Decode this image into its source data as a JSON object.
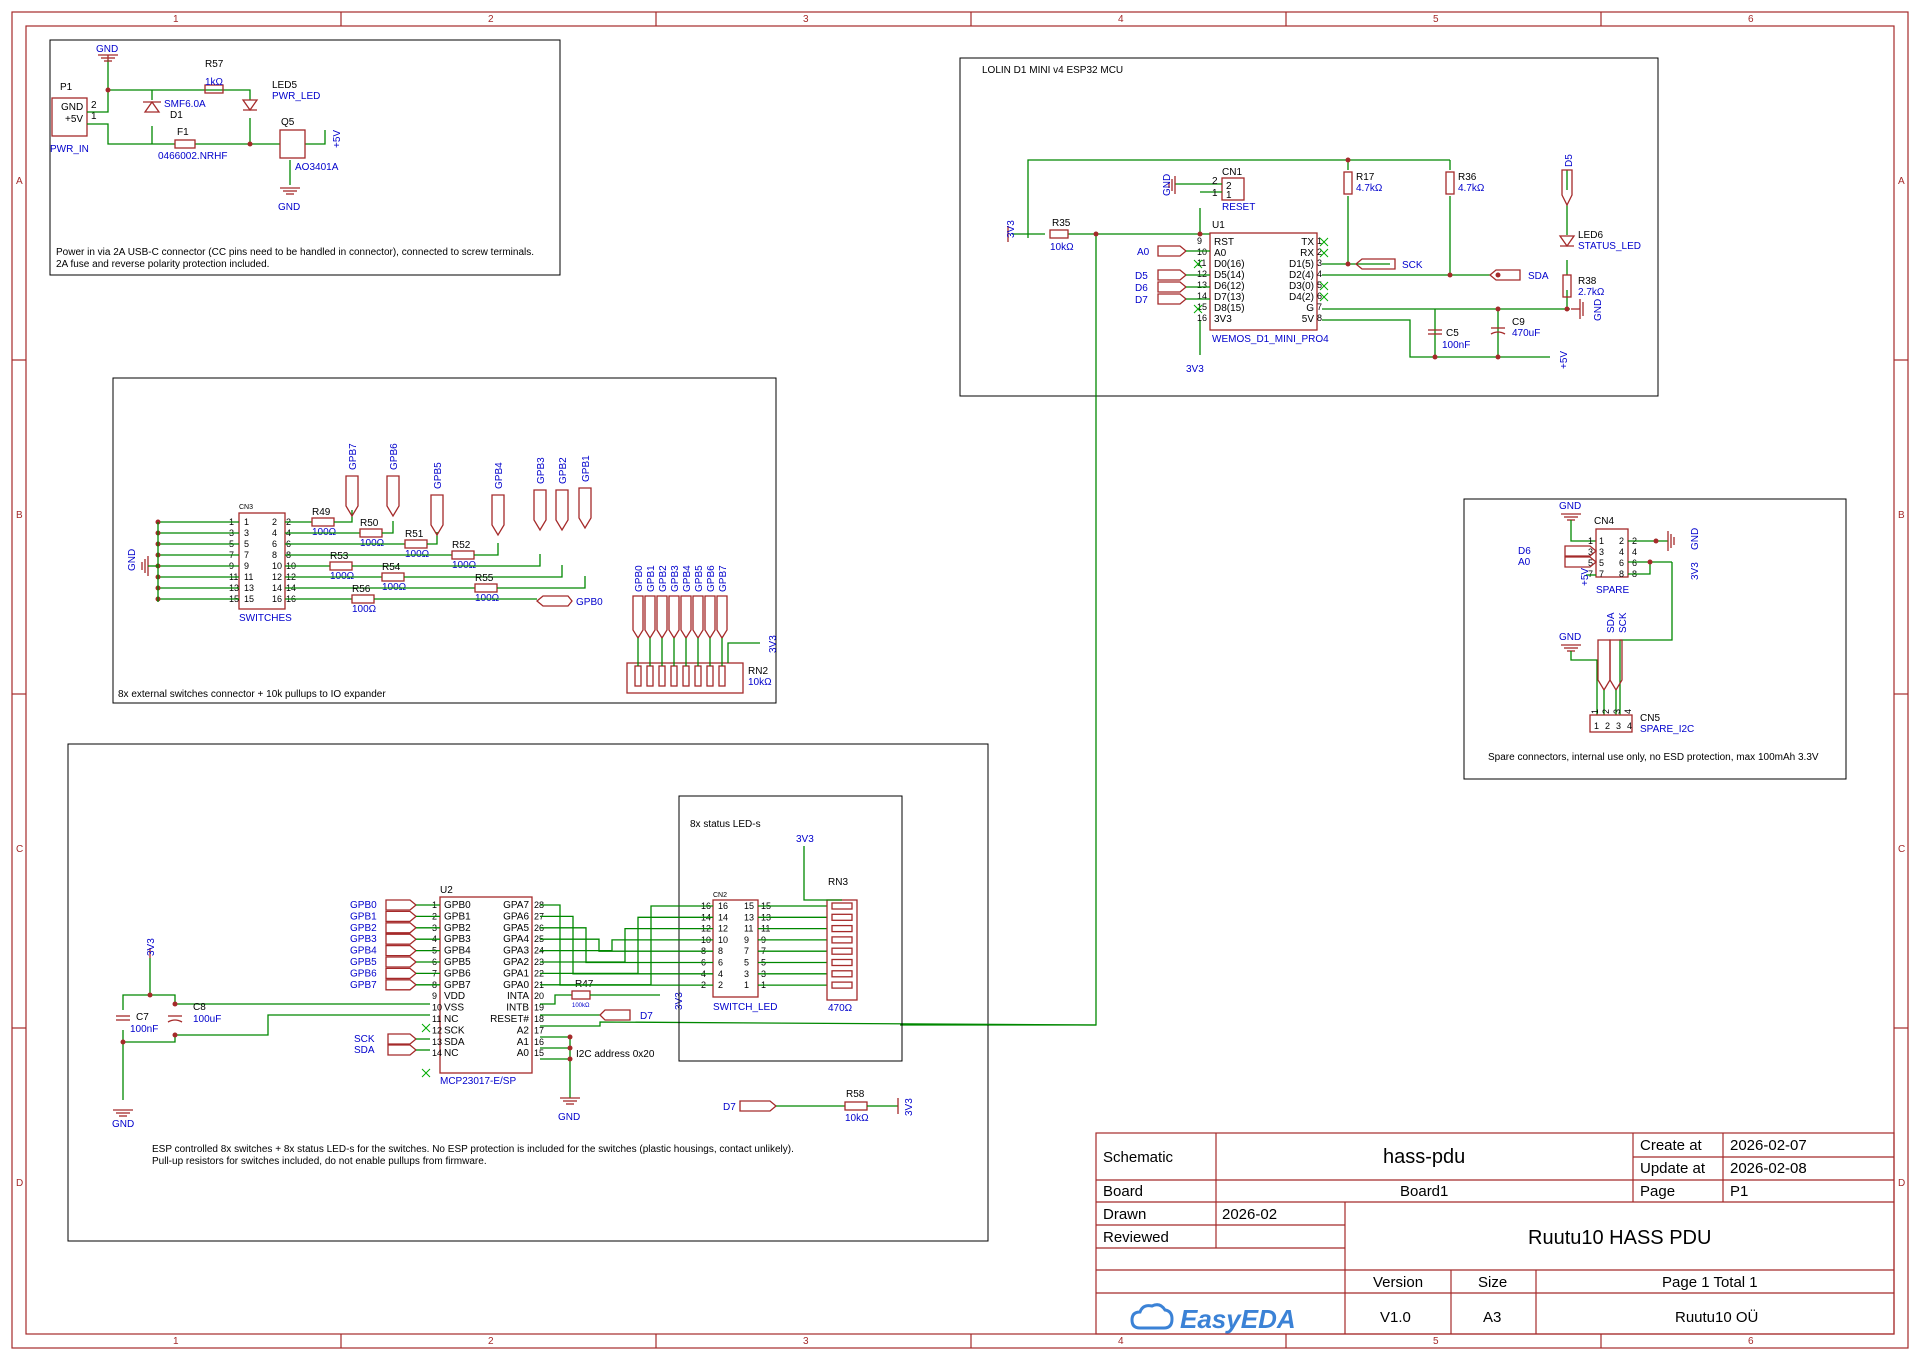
{
  "sheet": {
    "col_labels": [
      "1",
      "2",
      "3",
      "4",
      "5",
      "6"
    ],
    "row_labels": [
      "A",
      "B",
      "C",
      "D"
    ]
  },
  "power": {
    "note_line1": "Power in via 2A USB-C connector (CC pins need to be handled in connector), connected to screw terminals.",
    "note_line2": "2A fuse and reverse polarity protection included.",
    "p1_ref": "P1",
    "p1_name": "PWR_IN",
    "p1_pin_gnd": "GND",
    "p1_pin_5v": "+5V",
    "p1_num2": "2",
    "p1_num1": "1",
    "gnd_top": "GND",
    "gnd_bottom": "GND",
    "r57_ref": "R57",
    "r57_val": "1kΩ",
    "led5_ref": "LED5",
    "led5_name": "PWR_LED",
    "d1_part": "SMF6.0A",
    "d1_ref": "D1",
    "f1_ref": "F1",
    "f1_part": "0466002.NRHF",
    "q5_ref": "Q5",
    "q5_part": "AO3401A",
    "p5v": "+5V"
  },
  "mcu": {
    "title": "LOLIN D1 MINI v4 ESP32 MCU",
    "cn1_ref": "CN1",
    "cn1_name": "RESET",
    "cn1_p2": "2",
    "cn1_p1": "1",
    "gnd": "GND",
    "v33_left": "3V3",
    "r35_ref": "R35",
    "r35_val": "10kΩ",
    "r17_ref": "R17",
    "r17_val": "4.7kΩ",
    "r36_ref": "R36",
    "r36_val": "4.7kΩ",
    "u1_ref": "U1",
    "u1_name": "WEMOS_D1_MINI_PRO4",
    "left_pins": [
      {
        "num": "9",
        "name": "RST"
      },
      {
        "num": "10",
        "name": "A0"
      },
      {
        "num": "11",
        "name": "D0(16)"
      },
      {
        "num": "12",
        "name": "D5(14)"
      },
      {
        "num": "13",
        "name": "D6(12)"
      },
      {
        "num": "14",
        "name": "D7(13)"
      },
      {
        "num": "15",
        "name": "D8(15)"
      },
      {
        "num": "16",
        "name": "3V3"
      }
    ],
    "right_pins": [
      {
        "num": "1",
        "name": "TX"
      },
      {
        "num": "2",
        "name": "RX"
      },
      {
        "num": "3",
        "name": "D1(5)"
      },
      {
        "num": "4",
        "name": "D2(4)"
      },
      {
        "num": "5",
        "name": "D3(0)"
      },
      {
        "num": "6",
        "name": "D4(2)"
      },
      {
        "num": "7",
        "name": "G"
      },
      {
        "num": "8",
        "name": "5V"
      }
    ],
    "net_a0": "A0",
    "net_d5": "D5",
    "net_d6": "D6",
    "net_d7": "D7",
    "net_sck": "SCK",
    "net_sda": "SDA",
    "v33_bottom": "3V3",
    "c5_ref": "C5",
    "c5_val": "100nF",
    "c9_ref": "C9",
    "c9_val": "470uF",
    "p5v": "+5V",
    "d5_net": "D5",
    "led6_ref": "LED6",
    "led6_name": "STATUS_LED",
    "r38_ref": "R38",
    "r38_val": "2.7kΩ",
    "gnd_r": "GND"
  },
  "switches": {
    "note": "8x external switches connector + 10k pullups to IO expander",
    "cn3_ref": "CN3",
    "cn3_name": "SWITCHES",
    "gnd": "GND",
    "left_nums": [
      "1",
      "3",
      "5",
      "7",
      "9",
      "11",
      "13",
      "15"
    ],
    "right_nums": [
      "2",
      "4",
      "6",
      "8",
      "10",
      "12",
      "14",
      "16"
    ],
    "ref_nets": [
      "GPB7",
      "GPB6",
      "GPB5",
      "GPB4",
      "GPB3",
      "GPB2",
      "GPB1"
    ],
    "gpb0": "GPB0",
    "resistors": [
      {
        "ref": "R49",
        "val": "100Ω"
      },
      {
        "ref": "R50",
        "val": "100Ω"
      },
      {
        "ref": "R51",
        "val": "100Ω"
      },
      {
        "ref": "R52",
        "val": "100Ω"
      },
      {
        "ref": "R53",
        "val": "100Ω"
      },
      {
        "ref": "R54",
        "val": "100Ω"
      },
      {
        "ref": "R55",
        "val": "100Ω"
      },
      {
        "ref": "R56",
        "val": "100Ω"
      }
    ],
    "rn2_nets": [
      "GPB0",
      "GPB1",
      "GPB2",
      "GPB3",
      "GPB4",
      "GPB5",
      "GPB6",
      "GPB7"
    ],
    "rn2_ref": "RN2",
    "rn2_val": "10kΩ",
    "v33": "3V3"
  },
  "spare": {
    "note": "Spare connectors, internal use only, no ESD protection, max 100mAh 3.3V",
    "gnd_top": "GND",
    "cn4_ref": "CN4",
    "cn4_name": "SPARE",
    "cn4_left": [
      "1",
      "3",
      "5",
      "7"
    ],
    "cn4_right": [
      "2",
      "4",
      "6",
      "8"
    ],
    "net_d6": "D6",
    "net_a0": "A0",
    "p5v": "+5V",
    "gnd_r": "GND",
    "v33_r": "3V3",
    "gnd2": "GND",
    "net_sda": "SDA",
    "net_sck": "SCK",
    "cn5_ref": "CN5",
    "cn5_name": "SPARE_I2C",
    "cn5_nums": [
      "1",
      "2",
      "3",
      "4"
    ]
  },
  "expander": {
    "note_line1": "ESP controlled 8x switches + 8x status LED-s for the switches. No ESP protection is included for the switches (plastic housings, contact unlikely).",
    "note_line2": "Pull-up resistors for switches included, do not enable pullups from firmware.",
    "v33": "3V3",
    "c7_ref": "C7",
    "c7_val": "100nF",
    "c8_ref": "C8",
    "c8_val": "100uF",
    "gnd": "GND",
    "u2_ref": "U2",
    "u2_name": "MCP23017-E/SP",
    "gpb_nets": [
      "GPB0",
      "GPB1",
      "GPB2",
      "GPB3",
      "GPB4",
      "GPB5",
      "GPB6",
      "GPB7"
    ],
    "left_pins": [
      {
        "num": "1",
        "name": "GPB0"
      },
      {
        "num": "2",
        "name": "GPB1"
      },
      {
        "num": "3",
        "name": "GPB2"
      },
      {
        "num": "4",
        "name": "GPB3"
      },
      {
        "num": "5",
        "name": "GPB4"
      },
      {
        "num": "6",
        "name": "GPB5"
      },
      {
        "num": "7",
        "name": "GPB6"
      },
      {
        "num": "8",
        "name": "GPB7"
      },
      {
        "num": "9",
        "name": "VDD"
      },
      {
        "num": "10",
        "name": "VSS"
      },
      {
        "num": "11",
        "name": "NC"
      },
      {
        "num": "12",
        "name": "SCK"
      },
      {
        "num": "13",
        "name": "SDA"
      },
      {
        "num": "14",
        "name": "NC"
      }
    ],
    "right_pins": [
      {
        "num": "28",
        "name": "GPA7"
      },
      {
        "num": "27",
        "name": "GPA6"
      },
      {
        "num": "26",
        "name": "GPA5"
      },
      {
        "num": "25",
        "name": "GPA4"
      },
      {
        "num": "24",
        "name": "GPA3"
      },
      {
        "num": "23",
        "name": "GPA2"
      },
      {
        "num": "22",
        "name": "GPA1"
      },
      {
        "num": "21",
        "name": "GPA0"
      },
      {
        "num": "20",
        "name": "INTA"
      },
      {
        "num": "19",
        "name": "INTB"
      },
      {
        "num": "18",
        "name": "RESET#"
      },
      {
        "num": "17",
        "name": "A2"
      },
      {
        "num": "16",
        "name": "A1"
      },
      {
        "num": "15",
        "name": "A0"
      }
    ],
    "net_sck": "SCK",
    "net_sda": "SDA",
    "r47_ref": "R47",
    "r47_val": "100kΩ",
    "net_d7": "D7",
    "v33_r47": "3V3",
    "i2c_note": "I2C address 0x20",
    "gnd_bottom": "GND",
    "led_title": "8x status LED-s",
    "cn2_ref": "CN2",
    "cn2_name": "SWITCH_LED",
    "cn2_left": [
      "16",
      "14",
      "12",
      "10",
      "8",
      "6",
      "4",
      "2"
    ],
    "cn2_right": [
      "15",
      "13",
      "11",
      "9",
      "7",
      "5",
      "3",
      "1"
    ],
    "rn3_ref": "RN3",
    "rn3_val": "470Ω",
    "rn3_v33": "3V3",
    "rn3_nums": [
      "16",
      "15",
      "14",
      "13",
      "12",
      "11",
      "10",
      "9",
      "8",
      "7",
      "6",
      "5",
      "4",
      "3",
      "2",
      "1"
    ],
    "d7_net": "D7",
    "r58_ref": "R58",
    "r58_val": "10kΩ",
    "r58_v33": "3V3"
  },
  "title_block": {
    "schematic_label": "Schematic",
    "schematic_value": "hass-pdu",
    "create_label": "Create at",
    "create_value": "2026-02-07",
    "update_label": "Update at",
    "update_value": "2026-02-08",
    "board_label": "Board",
    "board_value": "Board1",
    "page_label": "Page",
    "page_value": "P1",
    "drawn_label": "Drawn",
    "drawn_value": "2026-02",
    "reviewed_label": "Reviewed",
    "project_title": "Ruutu10 HASS PDU",
    "version_label": "Version",
    "version_value": "V1.0",
    "size_label": "Size",
    "size_value": "A3",
    "page_total": "Page  1  Total  1",
    "company": "Ruutu10 OÜ",
    "logo_text": "EasyEDA"
  },
  "colors": {
    "frame": "#a52a2a",
    "wire": "#008800",
    "net_label_text": "#0000cc",
    "logo": "#3b82d6"
  }
}
